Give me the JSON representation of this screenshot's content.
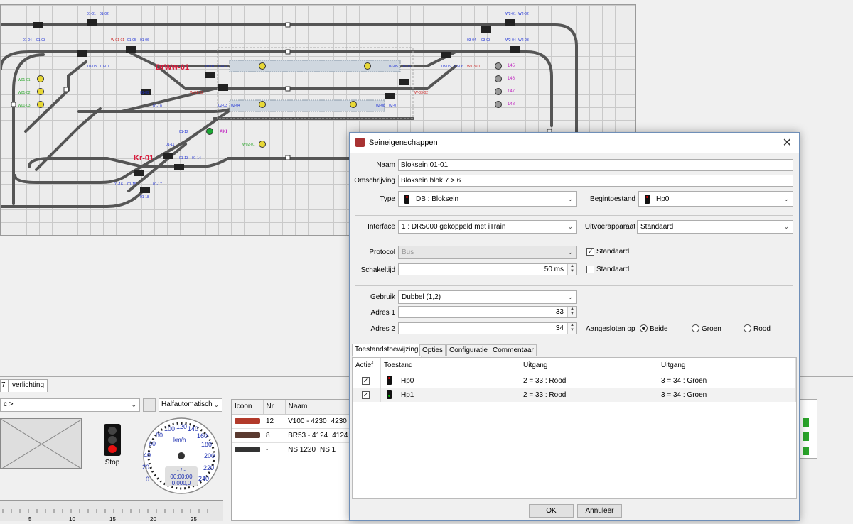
{
  "layout": {
    "block_labels": [
      "01-01",
      "01-02",
      "01-04",
      "01-03",
      "W-01-01",
      "01-05",
      "01-06",
      "01-08",
      "01-07",
      "01-09",
      "01-10",
      "01-12",
      "01-11",
      "01-13",
      "01-14",
      "01-16",
      "01-15",
      "01-17",
      "01-18",
      "02-01",
      "02-02",
      "02-03",
      "02-04",
      "02-05",
      "02-06",
      "02-07",
      "02-08",
      "03-05",
      "03-06",
      "03-04",
      "W-03-01",
      "W-03-02",
      "W-01-02",
      "03-03",
      "W2-01",
      "W2-02",
      "W2-04",
      "W2-03"
    ],
    "green_labels": [
      "W01-01",
      "W01-02",
      "W01-03",
      "W02-01"
    ],
    "side_numbers": [
      "145",
      "146",
      "147",
      "148"
    ],
    "big_labels": [
      "DrWw-01",
      "Kr-01"
    ],
    "aki_label": "AKI"
  },
  "lower": {
    "tabs": [
      "7",
      "verlichting"
    ],
    "train_selector": "c >",
    "mode": "Halfautomatisch",
    "signal_label": "Stop",
    "gauge": {
      "ticks": [
        "0",
        "20",
        "40",
        "60",
        "80",
        "100",
        "120",
        "140",
        "160",
        "180",
        "200",
        "220",
        "240"
      ],
      "unit": "km/h",
      "speed": "- / -",
      "time": "00:00:00",
      "odo": "0.000,0"
    },
    "ruler_ticks": [
      "5",
      "10",
      "15",
      "20",
      "25"
    ],
    "loco_table": {
      "headers": [
        "Icoon",
        "Nr",
        "Naam"
      ],
      "rows": [
        {
          "nr": "12",
          "naam": "V100 - 4230",
          "extra": "4230"
        },
        {
          "nr": "8",
          "naam": "BR53 - 4124",
          "extra": "4124"
        },
        {
          "nr": "-",
          "naam": "NS 1220",
          "extra": "NS 1"
        }
      ]
    }
  },
  "dialog": {
    "title": "Seineigenschappen",
    "naam_label": "Naam",
    "naam": "Bloksein 01-01",
    "omschrijving_label": "Omschrijving",
    "omschrijving": "Bloksein blok 7 > 6",
    "type_label": "Type",
    "type": "DB : Bloksein",
    "begintoestand_label": "Begintoestand",
    "begintoestand": "Hp0",
    "interface_label": "Interface",
    "interface": "1 : DR5000 gekoppeld met iTrain",
    "uitvoer_label": "Uitvoerapparaat",
    "uitvoer": "Standaard",
    "protocol_label": "Protocol",
    "protocol": "Bus",
    "standaard1": "Standaard",
    "schakeltijd_label": "Schakeltijd",
    "schakeltijd": "50 ms",
    "standaard2": "Standaard",
    "gebruik_label": "Gebruik",
    "gebruik": "Dubbel (1,2)",
    "adres1_label": "Adres 1",
    "adres1": "33",
    "adres2_label": "Adres 2",
    "adres2": "34",
    "aangesloten_label": "Aangesloten op",
    "opt_beide": "Beide",
    "opt_groen": "Groen",
    "opt_rood": "Rood",
    "tabs": [
      "Toestandstoewijzing",
      "Opties",
      "Configuratie",
      "Commentaar"
    ],
    "grid_headers": [
      "Actief",
      "Toestand",
      "Uitgang",
      "Uitgang"
    ],
    "grid_rows": [
      {
        "toestand": "Hp0",
        "uit1": "2 = 33 : Rood",
        "uit2": "3 = 34 : Groen"
      },
      {
        "toestand": "Hp1",
        "uit1": "2 = 33 : Rood",
        "uit2": "3 = 34 : Groen"
      }
    ],
    "ok": "OK",
    "cancel": "Annuleer"
  }
}
